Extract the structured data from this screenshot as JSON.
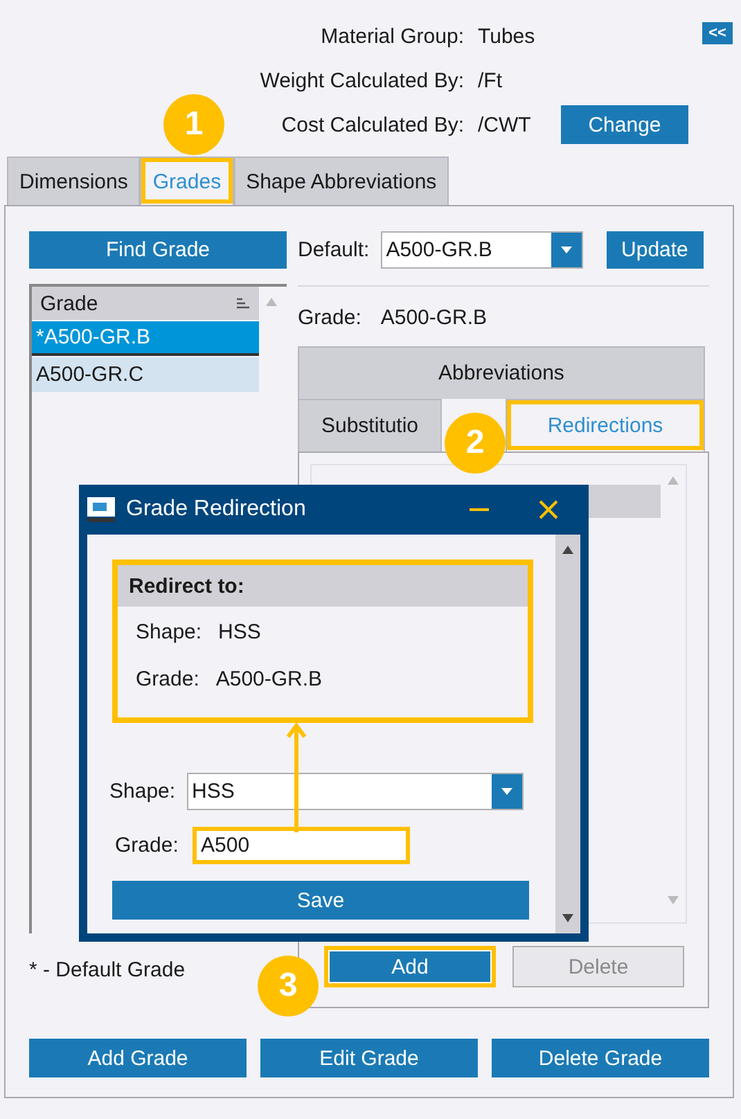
{
  "header": {
    "fields": [
      {
        "label": "Material Group:",
        "value": "Tubes"
      },
      {
        "label": "Weight Calculated By:",
        "value": "/Ft"
      },
      {
        "label": "Cost Calculated By:",
        "value": "/CWT"
      }
    ],
    "change_button": "Change",
    "collapse_button": "<<"
  },
  "tabs": [
    {
      "label": "Dimensions",
      "selected": false,
      "highlighted": false
    },
    {
      "label": "Grades",
      "selected": true,
      "highlighted": true
    },
    {
      "label": "Shape Abbreviations",
      "selected": false,
      "highlighted": false
    }
  ],
  "find_grade_button": "Find Grade",
  "default": {
    "label": "Default:",
    "value": "A500-GR.B"
  },
  "update_button": "Update",
  "grade_list": {
    "column": "Grade",
    "rows": [
      {
        "text": "*A500-GR.B",
        "selected": true
      },
      {
        "text": "A500-GR.C",
        "selected": false
      }
    ]
  },
  "current_grade": {
    "label": "Grade:",
    "value": "A500-GR.B"
  },
  "sub_tabs": [
    {
      "label": "Abbreviations",
      "selected": false,
      "highlighted": false
    },
    {
      "label": "Substitutio",
      "selected": false,
      "highlighted": false
    },
    {
      "label": "Redirections",
      "selected": true,
      "highlighted": true
    }
  ],
  "redirection_buttons": [
    {
      "label": "Add",
      "disabled": false,
      "highlighted": true
    },
    {
      "label": "Delete",
      "disabled": true,
      "highlighted": false
    }
  ],
  "footnote": "* - Default Grade",
  "bottom_buttons": [
    "Add Grade",
    "Edit Grade",
    "Delete Grade"
  ],
  "dialog": {
    "title": "Grade Redirection",
    "summary": {
      "heading": "Redirect to:",
      "highlighted": true,
      "rows": [
        {
          "label": "Shape:",
          "value": "HSS"
        },
        {
          "label": "Grade:",
          "value": "A500-GR.B"
        }
      ]
    },
    "shape": {
      "label": "Shape:",
      "value": "HSS"
    },
    "grade": {
      "label": "Grade:",
      "value": "A500",
      "highlighted": true
    },
    "save_button": "Save"
  },
  "callouts": [
    {
      "label": "1"
    },
    {
      "label": "2"
    },
    {
      "label": "3"
    }
  ]
}
